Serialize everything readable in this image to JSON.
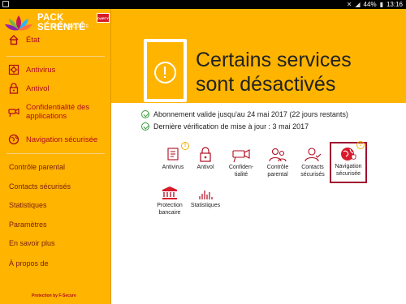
{
  "statusbar": {
    "battery": "44%",
    "time": "13:16"
  },
  "brand": {
    "title": "PACK SÉRÉNITÉ",
    "subtitle": "DARTY SÉCURITÉ",
    "partner_logo": "DARTY"
  },
  "sidebar": {
    "items": [
      {
        "label": "État",
        "icon": "home-icon"
      },
      {
        "label": "Antivirus",
        "icon": "antivirus-icon"
      },
      {
        "label": "Antivol",
        "icon": "lock-icon"
      },
      {
        "label": "Confidentialité des applications",
        "icon": "camera-icon"
      },
      {
        "label": "Navigation sécurisée",
        "icon": "globe-icon"
      }
    ],
    "plain_items": [
      {
        "label": "Contrôle parental"
      },
      {
        "label": "Contacts sécurisés"
      },
      {
        "label": "Statistiques"
      },
      {
        "label": "Paramètres"
      },
      {
        "label": "En savoir plus"
      },
      {
        "label": "À propos de"
      }
    ],
    "footer": "Protection by F-Secure"
  },
  "hero": {
    "title": "Certains services sont désactivés"
  },
  "status_lines": [
    {
      "text": "Abonnement valide jusqu'au 24 mai 2017 (22 jours restants)"
    },
    {
      "text": "Dernière vérification de mise à jour : 3 mai 2017"
    }
  ],
  "tiles": [
    {
      "label": "Antivirus",
      "icon": "antivirus-icon",
      "warning": true
    },
    {
      "label": "Antivol",
      "icon": "lock-icon",
      "warning": false
    },
    {
      "label": "Confiden-\ntialité",
      "icon": "camera-icon",
      "warning": false
    },
    {
      "label": "Contrôle\nparental",
      "icon": "parental-icon",
      "warning": false
    },
    {
      "label": "Contacts\nsécurisés",
      "icon": "contacts-icon",
      "warning": false
    },
    {
      "label": "Navigation\nsécurisée",
      "icon": "globe-icon",
      "warning": true,
      "selected": true
    },
    {
      "label": "Protection\nbancaire",
      "icon": "bank-icon",
      "warning": false
    },
    {
      "label": "Statistiques",
      "icon": "stats-icon",
      "warning": false
    }
  ],
  "colors": {
    "accent": "#ffb400",
    "brand_red": "#b00a1e",
    "ok_green": "#3b9b3b"
  }
}
